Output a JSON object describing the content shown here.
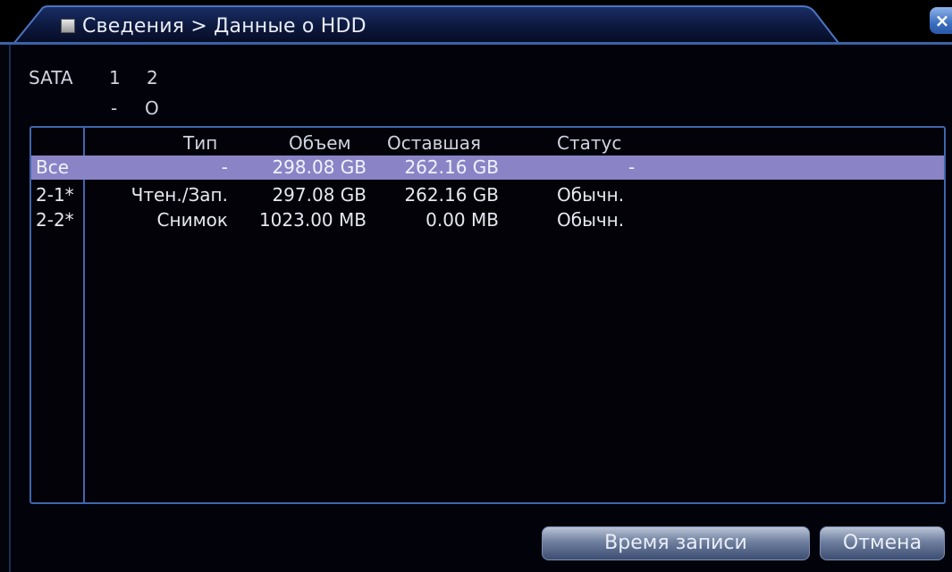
{
  "window": {
    "title": "Сведения > Данные о HDD",
    "close_label": "×"
  },
  "sata": {
    "label": "SATA",
    "ports": [
      "1",
      "2"
    ],
    "states": [
      "-",
      "O"
    ]
  },
  "table": {
    "columns": [
      "Тип",
      "Объем",
      "Оставшая",
      "Статус"
    ],
    "rows": [
      {
        "id": "Все",
        "type": "-",
        "capacity": "298.08 GB",
        "remaining": "262.16 GB",
        "status": "-",
        "selected": true
      },
      {
        "id": "2-1*",
        "type": "Чтен./Зап.",
        "capacity": "297.08 GB",
        "remaining": "262.16 GB",
        "status": "Обычн.",
        "selected": false
      },
      {
        "id": "2-2*",
        "type": "Снимок",
        "capacity": "1023.00 MB",
        "remaining": "0.00 MB",
        "status": "Обычн.",
        "selected": false
      }
    ]
  },
  "buttons": {
    "record_time": "Время записи",
    "cancel": "Отмена"
  },
  "colors": {
    "accent": "#3e66ae",
    "selected_row": "#8a84c6",
    "background": "#03030b"
  }
}
